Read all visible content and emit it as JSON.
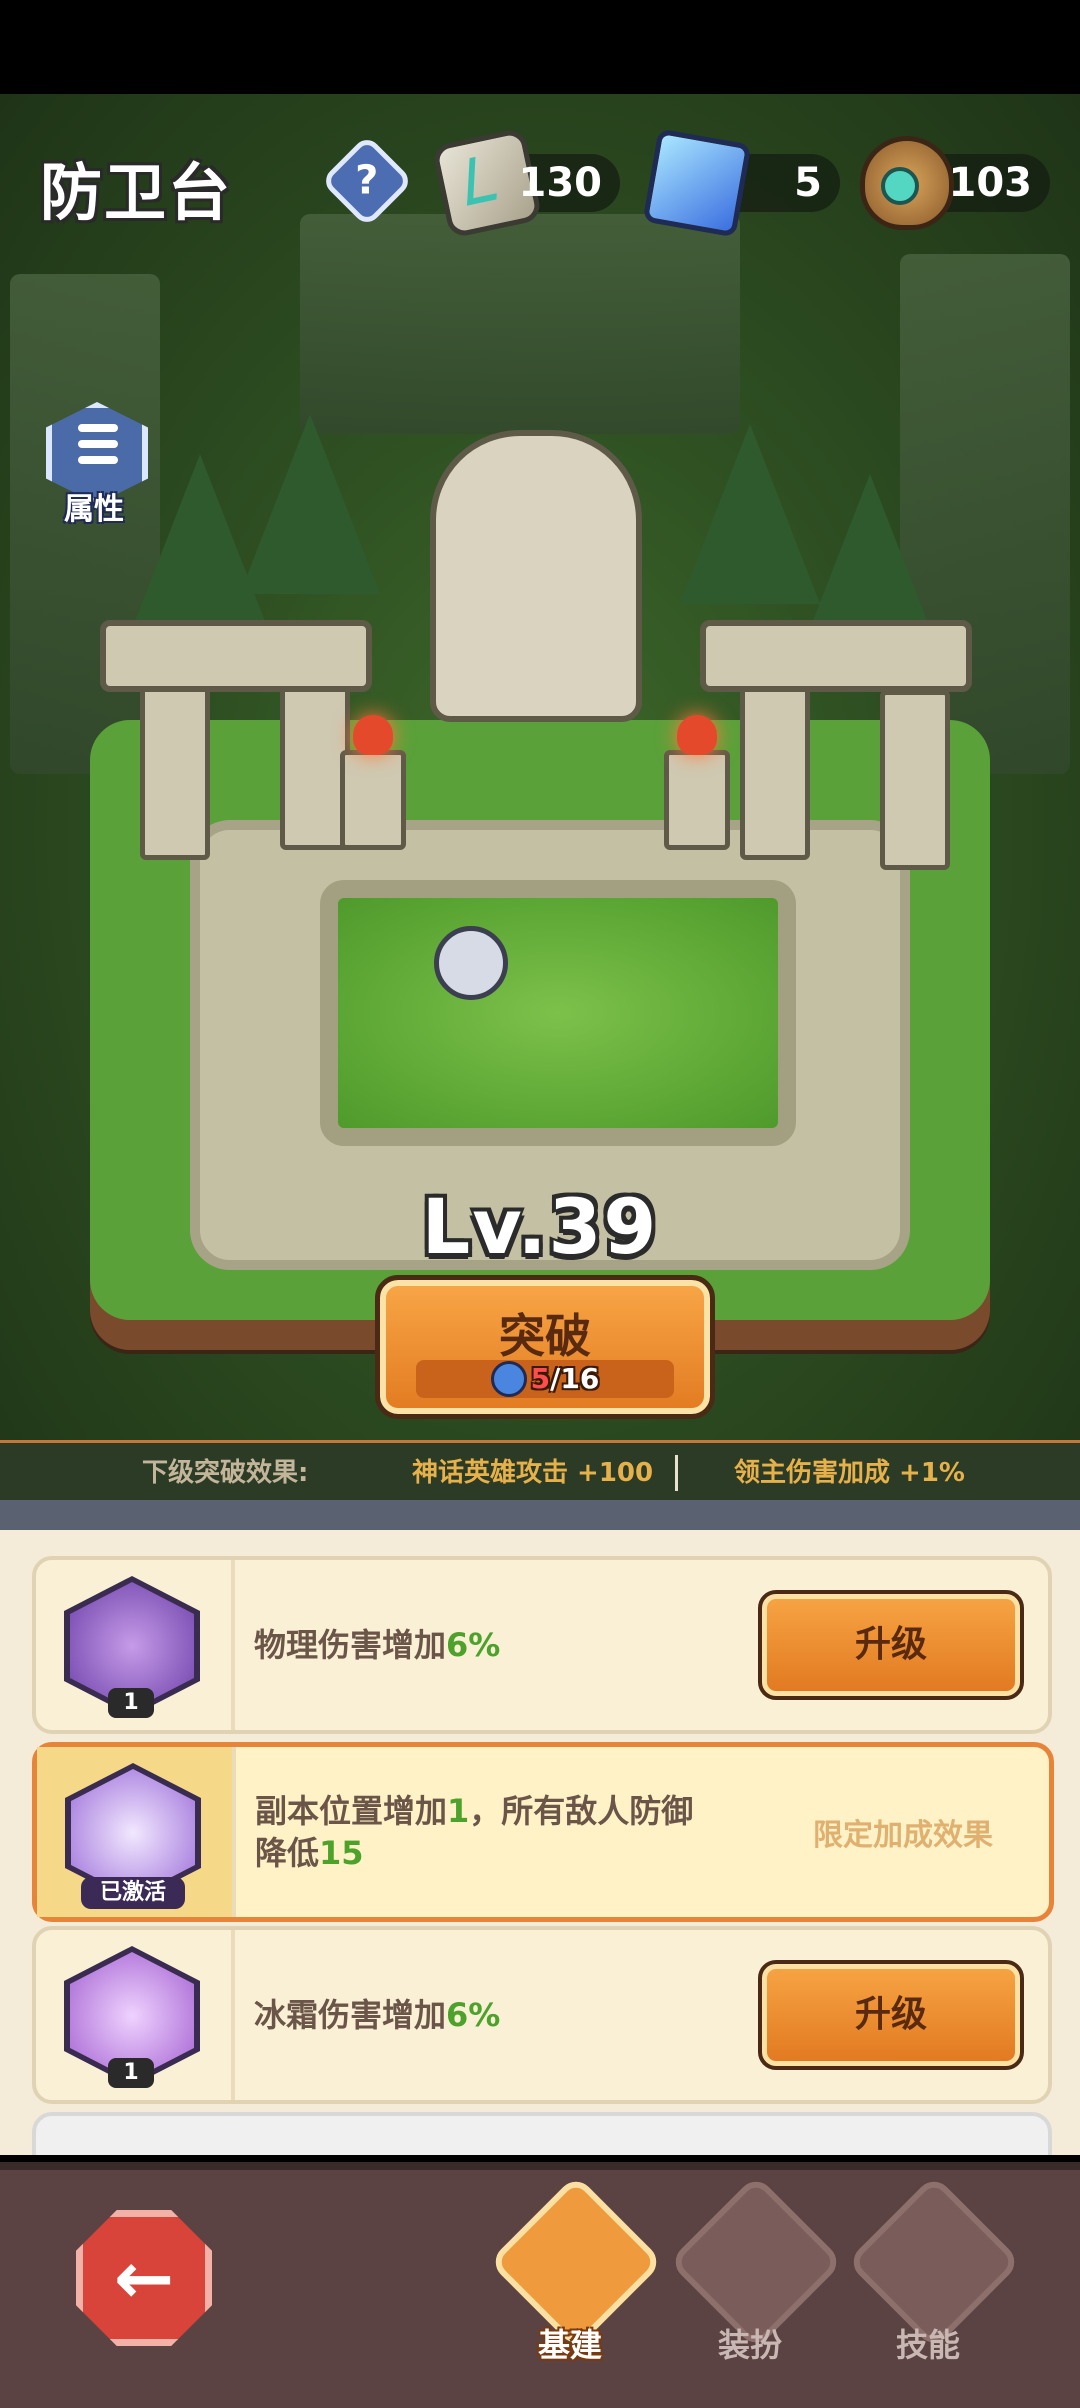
{
  "header": {
    "title": "防卫台",
    "help_icon": "?",
    "resources": [
      {
        "icon": "stone-icon",
        "value": "130"
      },
      {
        "icon": "crystal-icon",
        "value": "5"
      },
      {
        "icon": "pouch-icon",
        "value": "103"
      }
    ]
  },
  "attributes_button": {
    "label": "属性"
  },
  "level_text": "Lv.39",
  "breakthrough": {
    "label": "突破",
    "progress_current": "5",
    "progress_sep_total": "/16"
  },
  "next_effect": {
    "label": "下级突破效果:",
    "effect1": "神话英雄攻击  +100",
    "effect2": "领主伤害加成  +1%"
  },
  "cards": [
    {
      "desc_prefix": "物理伤害增加",
      "desc_value": "6%",
      "desc_suffix": "",
      "level": "1",
      "button": "升级"
    },
    {
      "desc_prefix": "副本位置增加",
      "desc_value": "1",
      "desc_mid": "，所有敌人防御降低",
      "desc_value2": "15",
      "badge": "已激活",
      "side_text": "限定加成效果"
    },
    {
      "desc_prefix": "冰霜伤害增加",
      "desc_value": "6%",
      "level": "1",
      "button": "升级"
    }
  ],
  "nav": [
    {
      "label": "基建",
      "active": true
    },
    {
      "label": "装扮",
      "active": false
    },
    {
      "label": "技能",
      "active": false
    }
  ],
  "colors": {
    "accent_orange": "#f09a3e",
    "value_green": "#4ca22a",
    "progress_red": "#ff4d4d"
  }
}
